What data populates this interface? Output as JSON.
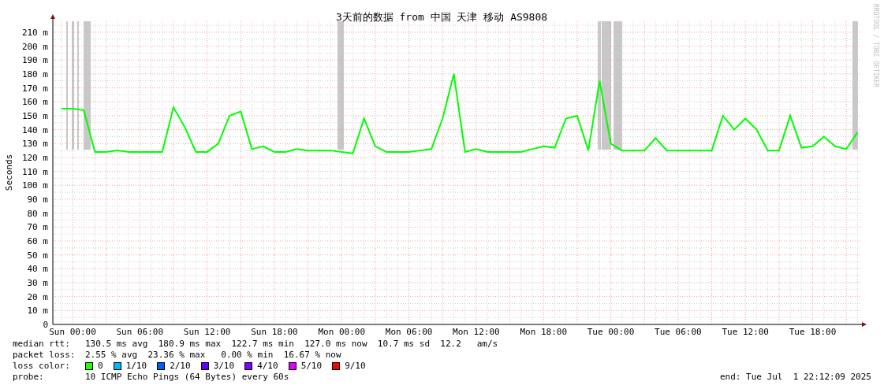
{
  "credit": "RRDTOOL / TOBI OETIKER",
  "chart_data": {
    "type": "line",
    "title": "3天前的数据 from 中国 天津 移动 AS9808",
    "ylabel": "Seconds",
    "categories": [
      null,
      "Sun 00:00",
      null,
      null,
      null,
      null,
      null,
      "Sun 06:00",
      null,
      null,
      null,
      null,
      null,
      "Sun 12:00",
      null,
      null,
      null,
      null,
      null,
      "Sun 18:00",
      null,
      null,
      null,
      null,
      null,
      "Mon 00:00",
      null,
      null,
      null,
      null,
      null,
      "Mon 06:00",
      null,
      null,
      null,
      null,
      null,
      "Mon 12:00",
      null,
      null,
      null,
      null,
      null,
      "Mon 18:00",
      null,
      null,
      null,
      null,
      null,
      "Tue 00:00",
      null,
      null,
      null,
      null,
      null,
      "Tue 06:00",
      null,
      null,
      null,
      null,
      null,
      "Tue 12:00",
      null,
      null,
      null,
      null,
      null,
      "Tue 18:00",
      null,
      null,
      null,
      null
    ],
    "series": [
      {
        "color": "#00ff00",
        "values": [
          155,
          155,
          154,
          124,
          124,
          125,
          124,
          124,
          124,
          124,
          156,
          142,
          124,
          124,
          130,
          150,
          153,
          126,
          128,
          124,
          124,
          126,
          125,
          125,
          125,
          124,
          123,
          148,
          128,
          124,
          124,
          124,
          125,
          126,
          148,
          180,
          124,
          126,
          124,
          124,
          124,
          124,
          126,
          128,
          127,
          148,
          150,
          125,
          175,
          130,
          125,
          125,
          125,
          134,
          125,
          125,
          125,
          125,
          125,
          150,
          140,
          148,
          140,
          125,
          125,
          150,
          127,
          128,
          135,
          128,
          126,
          138
        ]
      }
    ],
    "ylim": [
      0,
      218
    ],
    "grid": true,
    "yticks": [
      {
        "value": 0,
        "label": "0"
      },
      {
        "value": 10,
        "label": "10 m"
      },
      {
        "value": 20,
        "label": "20 m"
      },
      {
        "value": 30,
        "label": "30 m"
      },
      {
        "value": 40,
        "label": "40 m"
      },
      {
        "value": 50,
        "label": "50 m"
      },
      {
        "value": 60,
        "label": "60 m"
      },
      {
        "value": 70,
        "label": "70 m"
      },
      {
        "value": 80,
        "label": "80 m"
      },
      {
        "value": 90,
        "label": "90 m"
      },
      {
        "value": 100,
        "label": "100 m"
      },
      {
        "value": 110,
        "label": "110 m"
      },
      {
        "value": 120,
        "label": "120 m"
      },
      {
        "value": 130,
        "label": "130 m"
      },
      {
        "value": 140,
        "label": "140 m"
      },
      {
        "value": 150,
        "label": "150 m"
      },
      {
        "value": 160,
        "label": "160 m"
      },
      {
        "value": 170,
        "label": "170 m"
      },
      {
        "value": 180,
        "label": "180 m"
      },
      {
        "value": 190,
        "label": "190 m"
      },
      {
        "value": 200,
        "label": "200 m"
      },
      {
        "value": 210,
        "label": "210 m"
      }
    ]
  },
  "legend": {
    "median_rtt": {
      "label": "median rtt:",
      "text": "130.5 ms avg  180.9 ms max  122.7 ms min  127.0 ms now  10.7 ms sd  12.2   am/s"
    },
    "packet_loss": {
      "label": "packet loss:",
      "text": "2.55 % avg  23.36 % max   0.00 % min  16.67 % now"
    },
    "loss_color": {
      "label": "loss color:",
      "items": [
        {
          "label": "0",
          "color": "#22ff00"
        },
        {
          "label": "1/10",
          "color": "#00b8ff"
        },
        {
          "label": "2/10",
          "color": "#0059ff"
        },
        {
          "label": "3/10",
          "color": "#5e00ff"
        },
        {
          "label": "4/10",
          "color": "#7e00ff"
        },
        {
          "label": "5/10",
          "color": "#dd00ff"
        },
        {
          "label": "9/10",
          "color": "#ff0000"
        }
      ]
    },
    "probe": {
      "label": "probe:",
      "text": "10 ICMP Echo Pings (64 Bytes) every 60s"
    },
    "end": "end: Tue Jul  1 22:12:09 2025"
  }
}
